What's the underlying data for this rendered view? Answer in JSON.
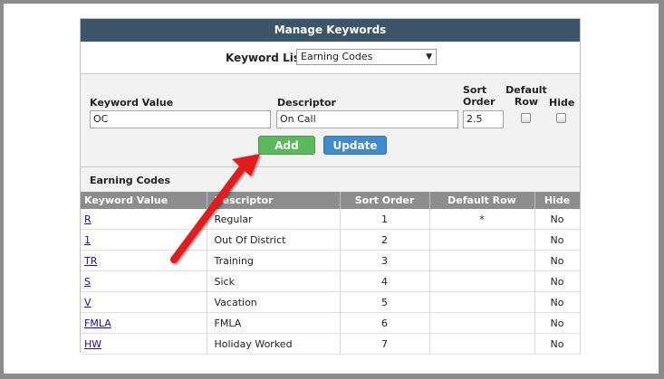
{
  "panel": {
    "title": "Manage Keywords",
    "keyword_lists_label": "Keyword Lists",
    "keyword_list_selected": "Earning Codes"
  },
  "form": {
    "keyword_value_label": "Keyword Value",
    "descriptor_label": "Descriptor",
    "sort_order_label_line1": "Sort",
    "sort_order_label_line2": "Order",
    "default_row_label_line1": "Default",
    "default_row_label_line2": "Row",
    "hide_label": "Hide",
    "keyword_value": "OC",
    "descriptor": "On Call",
    "sort_order": "2.5",
    "default_row_checked": false,
    "hide_checked": false,
    "add_label": "Add",
    "update_label": "Update"
  },
  "codes": {
    "title": "Earning Codes",
    "headers": {
      "keyword_value": "Keyword Value",
      "descriptor": "Descriptor",
      "sort_order": "Sort Order",
      "default_row": "Default Row",
      "hide": "Hide"
    },
    "rows": [
      {
        "keyword": "R",
        "descriptor": "Regular",
        "sort": "1",
        "default": "*",
        "hide": "No"
      },
      {
        "keyword": "1",
        "descriptor": "Out Of District",
        "sort": "2",
        "default": "",
        "hide": "No"
      },
      {
        "keyword": "TR",
        "descriptor": "Training",
        "sort": "3",
        "default": "",
        "hide": "No"
      },
      {
        "keyword": "S",
        "descriptor": "Sick",
        "sort": "4",
        "default": "",
        "hide": "No"
      },
      {
        "keyword": "V",
        "descriptor": "Vacation",
        "sort": "5",
        "default": "",
        "hide": "No"
      },
      {
        "keyword": "FMLA",
        "descriptor": "FMLA",
        "sort": "6",
        "default": "",
        "hide": "No"
      },
      {
        "keyword": "HW",
        "descriptor": "Holiday Worked",
        "sort": "7",
        "default": "",
        "hide": "No"
      }
    ]
  },
  "colors": {
    "header_bg": "#3d5568",
    "add_button": "#5cb85c",
    "update_button": "#428bca",
    "annotation_arrow": "#e21b1b"
  },
  "icons": {
    "dropdown": "chevron-down-icon",
    "annotation": "red-arrow-icon"
  }
}
